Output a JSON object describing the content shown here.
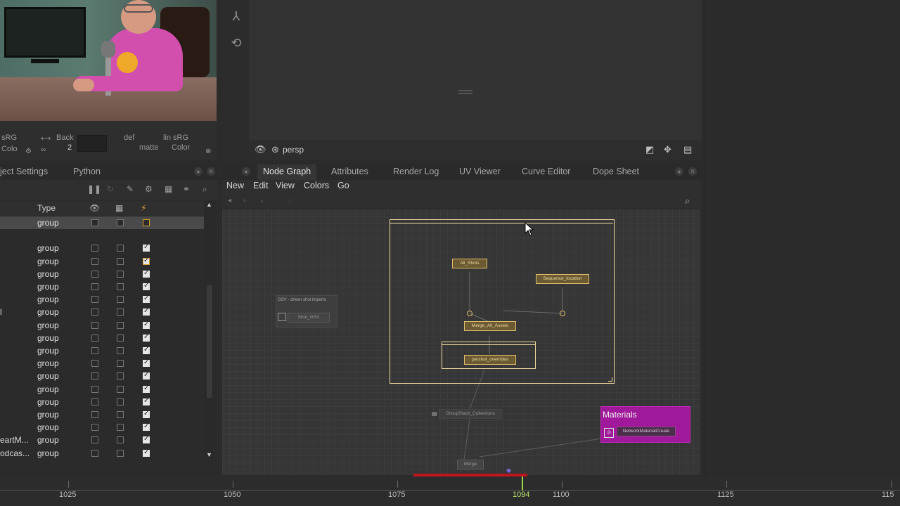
{
  "monitor": {
    "controls": {
      "srgb_top": "sRG",
      "color_left": "Colo",
      "back_label": "Back",
      "back_value": "2",
      "def_label": "def",
      "matte_label": "matte",
      "linear_label": "lin sRG",
      "color_right": "Color"
    }
  },
  "viewer": {
    "camera": "persp"
  },
  "left_panel": {
    "tabs": [
      "ject Settings",
      "Python"
    ],
    "columns": {
      "type": "Type"
    },
    "rows": [
      {
        "name": "",
        "type": "group",
        "c1": false,
        "c2": false,
        "c3": "gold",
        "selected": true
      },
      {
        "name": "",
        "type": "",
        "c1": null,
        "c2": null,
        "c3": null,
        "selected": false
      },
      {
        "name": "",
        "type": "group",
        "c1": false,
        "c2": false,
        "c3": "on"
      },
      {
        "name": "",
        "type": "group",
        "c1": false,
        "c2": false,
        "c3": "on-gold"
      },
      {
        "name": "",
        "type": "group",
        "c1": false,
        "c2": false,
        "c3": "on"
      },
      {
        "name": "",
        "type": "group",
        "c1": false,
        "c2": false,
        "c3": "on"
      },
      {
        "name": "",
        "type": "group",
        "c1": false,
        "c2": false,
        "c3": "on"
      },
      {
        "name": "l",
        "type": "group",
        "c1": false,
        "c2": false,
        "c3": "on"
      },
      {
        "name": "",
        "type": "group",
        "c1": false,
        "c2": false,
        "c3": "on"
      },
      {
        "name": "",
        "type": "group",
        "c1": false,
        "c2": false,
        "c3": "on"
      },
      {
        "name": "",
        "type": "group",
        "c1": false,
        "c2": false,
        "c3": "on"
      },
      {
        "name": "",
        "type": "group",
        "c1": false,
        "c2": false,
        "c3": "on"
      },
      {
        "name": "",
        "type": "group",
        "c1": false,
        "c2": false,
        "c3": "on"
      },
      {
        "name": "",
        "type": "group",
        "c1": false,
        "c2": false,
        "c3": "on"
      },
      {
        "name": "",
        "type": "group",
        "c1": false,
        "c2": false,
        "c3": "on"
      },
      {
        "name": "",
        "type": "group",
        "c1": false,
        "c2": false,
        "c3": "on"
      },
      {
        "name": "",
        "type": "group",
        "c1": false,
        "c2": false,
        "c3": "on"
      },
      {
        "name": "eartM...",
        "type": "group",
        "c1": false,
        "c2": false,
        "c3": "on"
      },
      {
        "name": "odcas...",
        "type": "group",
        "c1": false,
        "c2": false,
        "c3": "on"
      }
    ]
  },
  "node_graph": {
    "tabs": [
      "Node Graph",
      "Attributes",
      "Render Log",
      "UV Viewer",
      "Curve Editor",
      "Dope Sheet"
    ],
    "menu": [
      "New",
      "Edit",
      "View",
      "Colors",
      "Go"
    ],
    "nodes": {
      "all_shots": "All_Shots",
      "sequence_location": "Sequence_location",
      "merge_all_assets": "Merge_All_Assets",
      "pershot_overrides": "pershot_overrides",
      "gsv_backdrop": "GSV - driven shot imports",
      "shot_gsv": "Shot_GSV",
      "groupstack": "GroupStack_Collections",
      "merge": "Merge",
      "materials_title": "Materials",
      "network_material": "NetworkMaterialCreate"
    }
  },
  "timeline": {
    "labels": [
      "1025",
      "1050",
      "1075",
      "1094",
      "1100",
      "1125",
      "115"
    ],
    "current_frame": "1094"
  },
  "colors": {
    "accent_gold": "#e0be6c",
    "materials_magenta": "#a0199a",
    "current_frame_green": "#9fd64f",
    "range_red": "#c0141e"
  }
}
